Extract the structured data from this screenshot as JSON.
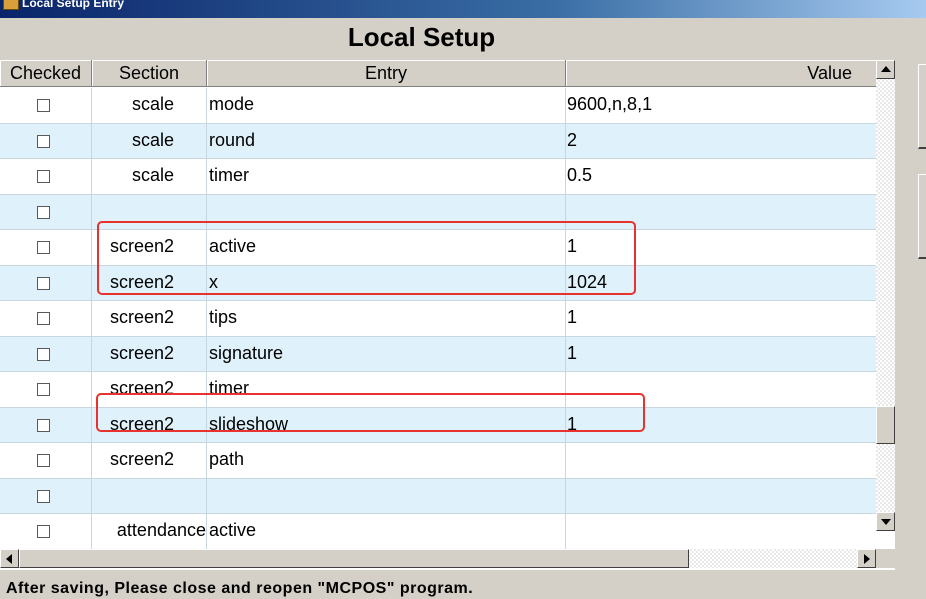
{
  "window": {
    "title": "Local Setup Entry"
  },
  "heading": "Local Setup",
  "table": {
    "columns": [
      "Checked",
      "Section",
      "Entry",
      "Value"
    ],
    "rows": [
      {
        "section": "scale",
        "entry": "mode",
        "value": "9600,n,8,1",
        "checked": false
      },
      {
        "section": "scale",
        "entry": "round",
        "value": "2",
        "checked": false
      },
      {
        "section": "scale",
        "entry": "timer",
        "value": "0.5",
        "checked": false
      },
      {
        "section": "",
        "entry": "",
        "value": "",
        "checked": false
      },
      {
        "section": "screen2",
        "entry": "active",
        "value": "1",
        "checked": false
      },
      {
        "section": "screen2",
        "entry": "x",
        "value": "1024",
        "checked": false
      },
      {
        "section": "screen2",
        "entry": "tips",
        "value": "1",
        "checked": false
      },
      {
        "section": "screen2",
        "entry": "signature",
        "value": "1",
        "checked": false
      },
      {
        "section": "screen2",
        "entry": "timer",
        "value": "",
        "checked": false
      },
      {
        "section": "screen2",
        "entry": "slideshow",
        "value": "1",
        "checked": false
      },
      {
        "section": "screen2",
        "entry": "path",
        "value": "",
        "checked": false
      },
      {
        "section": "",
        "entry": "",
        "value": "",
        "checked": false
      },
      {
        "section": "attendance",
        "entry": "active",
        "value": "",
        "checked": false
      }
    ]
  },
  "footer": "After saving, Please close and  reopen \"MCPOS\" program.",
  "colors": {
    "highlight": "#e8322e",
    "row_alt": "#dff1fb",
    "window_bg": "#d4d0c8"
  }
}
